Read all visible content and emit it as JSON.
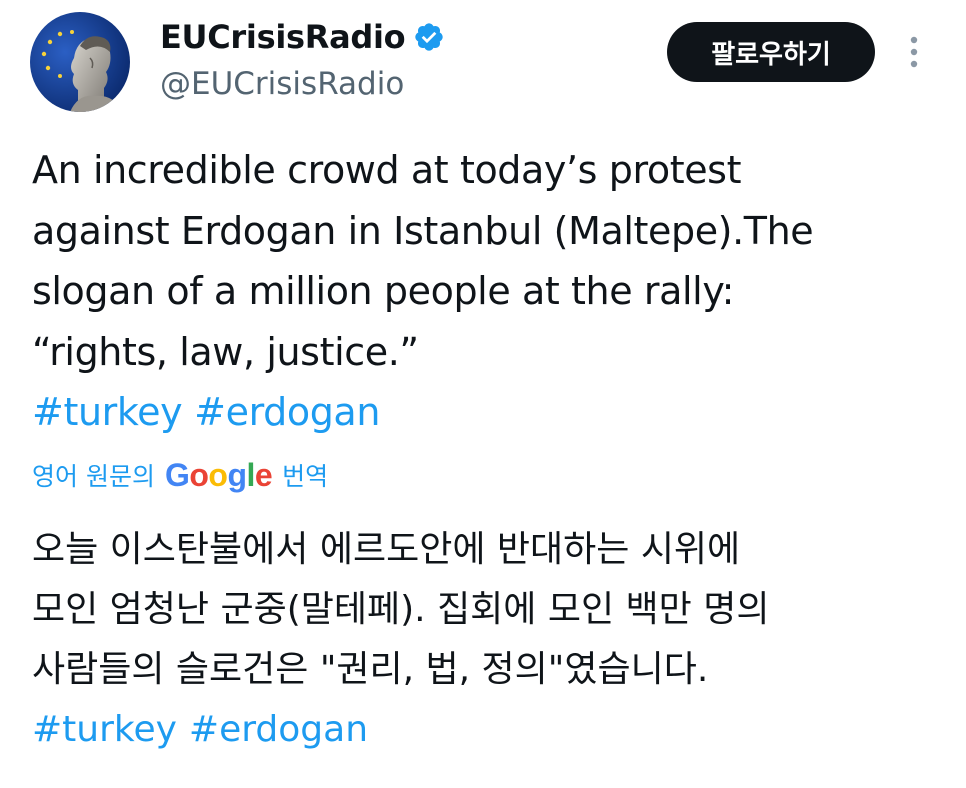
{
  "author": {
    "display_name": "EUCrisisRadio",
    "handle": "@EUCrisisRadio",
    "verified": true,
    "avatar_icon": "statue-with-eu-flag-avatar"
  },
  "follow_button": {
    "label": "팔로우하기"
  },
  "more_icon": "vertical-ellipsis-icon",
  "tweet": {
    "lines": [
      "An incredible crowd at today’s protest",
      "against Erdogan in Istanbul (Maltepe).The",
      "slogan of a million people at the rally:",
      "“rights, law, justice.”"
    ],
    "hashtags": [
      "#turkey",
      "#erdogan"
    ]
  },
  "translation": {
    "prefix": "영어 원문의",
    "provider": "Google",
    "suffix": "번역",
    "lines": [
      "오늘 이스탄불에서 에르도안에 반대하는 시위에",
      "모인 엄청난 군중(말테페). 집회에 모인 백만 명의",
      "사람들의 슬로건은 \"권리, 법, 정의\"였습니다."
    ],
    "hashtags": [
      "#turkey",
      "#erdogan"
    ]
  },
  "colors": {
    "link": "#1d9bf0",
    "text": "#0f1419",
    "secondary": "#536471",
    "button_bg": "#0f1419",
    "verified": "#1d9bf0"
  }
}
